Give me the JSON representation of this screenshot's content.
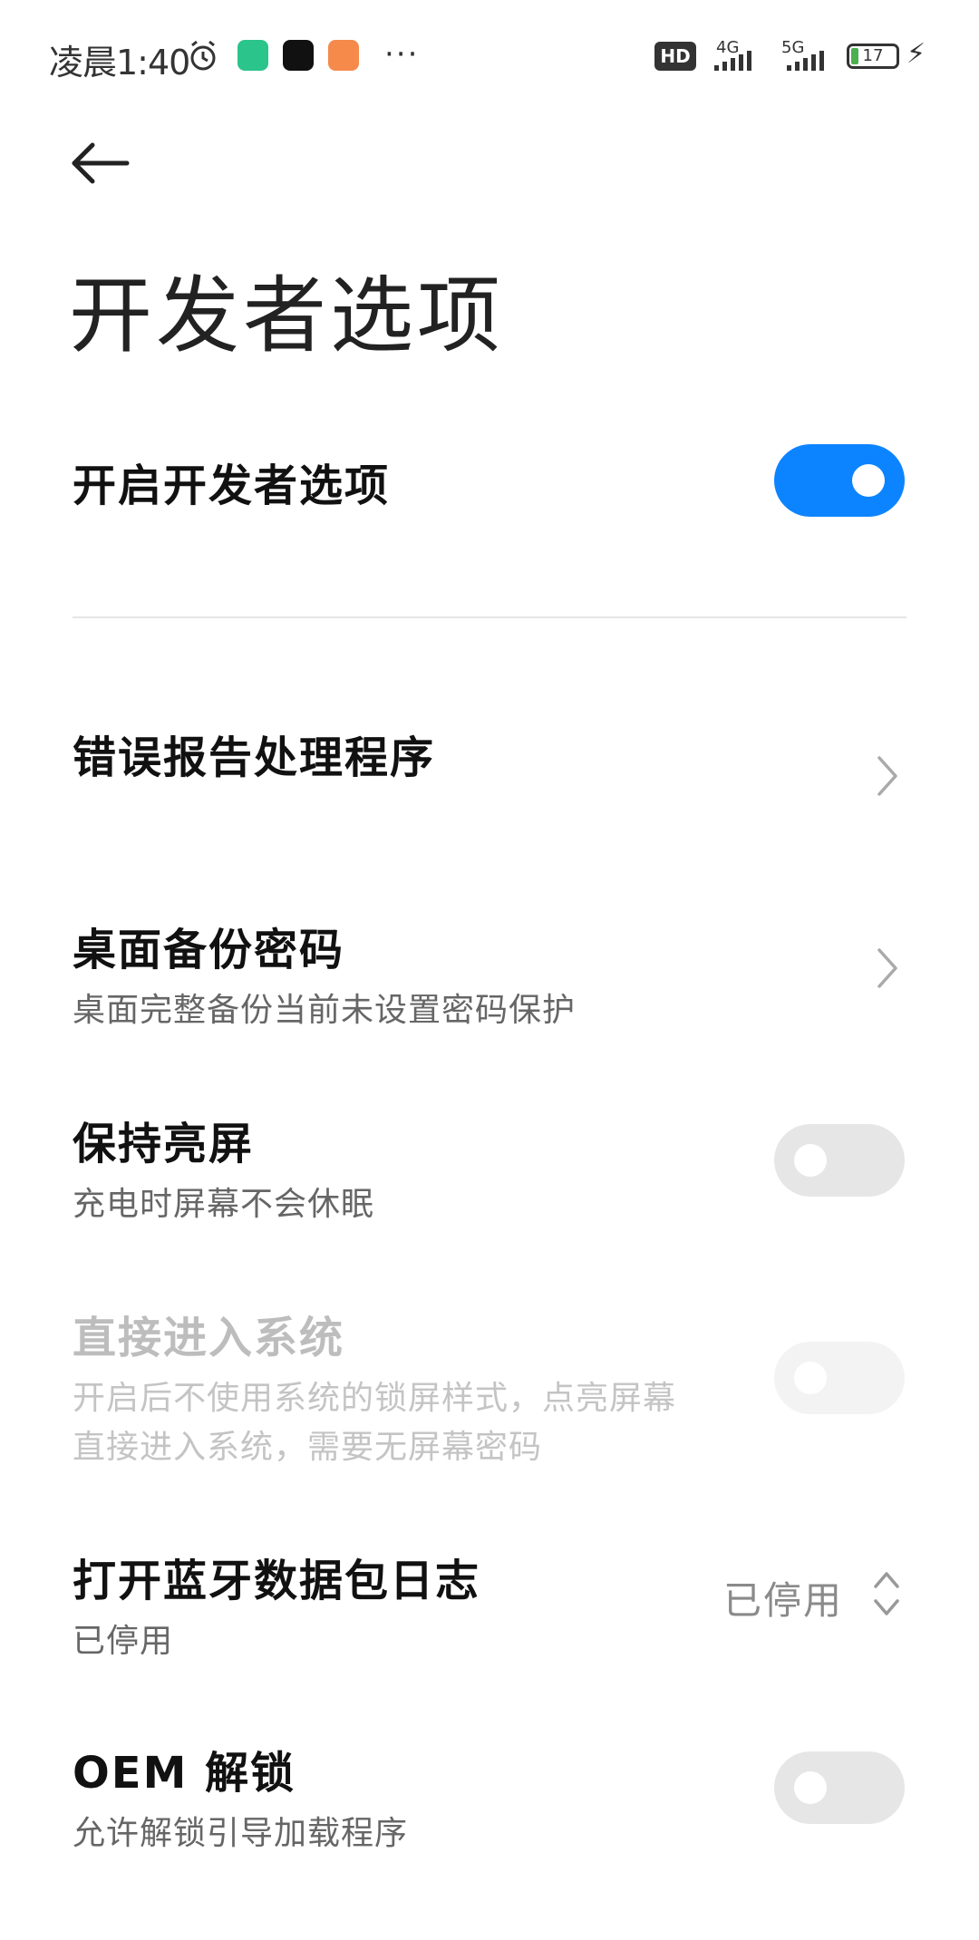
{
  "status_bar": {
    "time": "凌晨1:40",
    "more": "···",
    "hd": "HD",
    "net1": "4G",
    "net2": "5G",
    "battery": "17"
  },
  "page": {
    "title": "开发者选项"
  },
  "settings": {
    "developer_options": {
      "title": "开启开发者选项",
      "state": "on"
    },
    "error_report": {
      "title": "错误报告处理程序"
    },
    "desktop_backup": {
      "title": "桌面备份密码",
      "subtitle": "桌面完整备份当前未设置密码保护"
    },
    "stay_awake": {
      "title": "保持亮屏",
      "subtitle": "充电时屏幕不会休眠",
      "state": "off"
    },
    "direct_entry": {
      "title": "直接进入系统",
      "subtitle_line1": "开启后不使用系统的锁屏样式，点亮屏幕",
      "subtitle_line2": "直接进入系统，需要无屏幕密码",
      "state": "disabled"
    },
    "bluetooth_log": {
      "title": "打开蓝牙数据包日志",
      "subtitle": "已停用",
      "value": "已停用"
    },
    "oem_unlock": {
      "title": "OEM 解锁",
      "subtitle": "允许解锁引导加载程序",
      "state": "off"
    }
  },
  "colors": {
    "accent": "#0d84ff",
    "toggle_off": "#e6e6e6"
  }
}
